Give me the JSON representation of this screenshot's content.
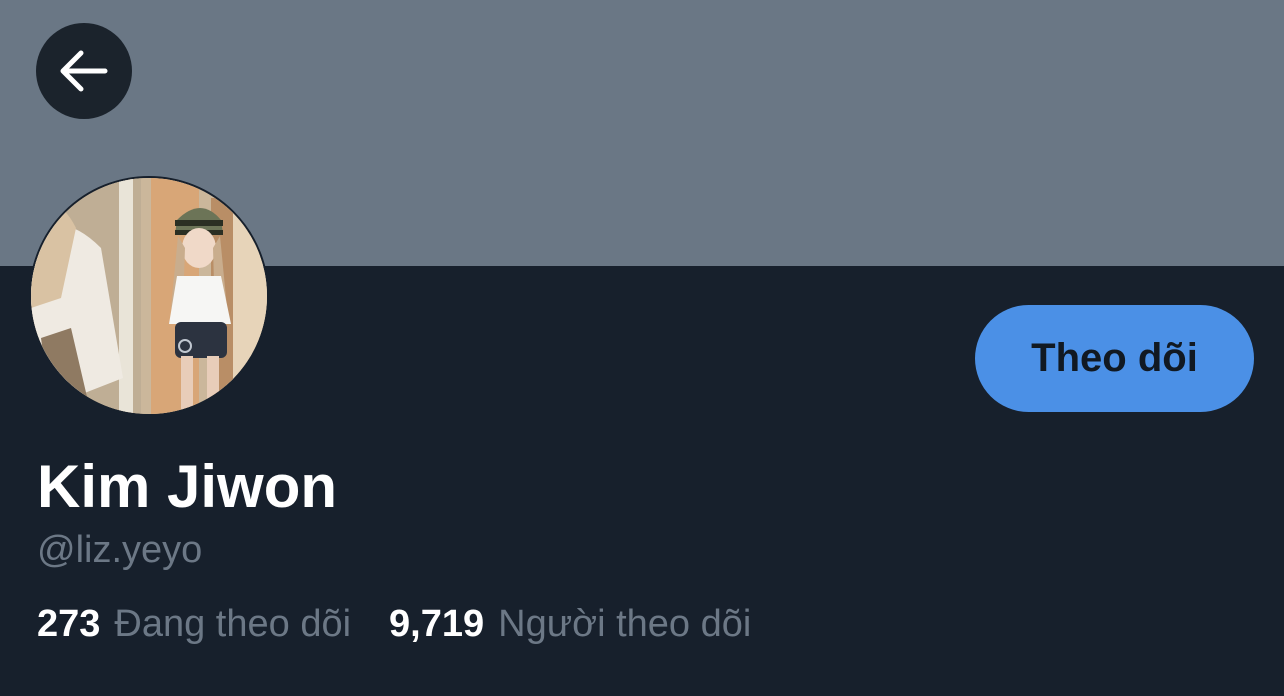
{
  "header": {
    "back_icon": "arrow-left-icon",
    "banner_color": "#6a7785"
  },
  "profile": {
    "avatar": "profile-photo",
    "display_name": "Kim Jiwon",
    "handle": "@liz.yeyo",
    "follow_label": "Theo dõi",
    "follow_color": "#4b90e6"
  },
  "stats": {
    "following_count": "273",
    "following_label": "Đang theo dõi",
    "followers_count": "9,719",
    "followers_label": "Người theo dõi"
  },
  "colors": {
    "background": "#17202c",
    "secondary_text": "#6c7886"
  }
}
